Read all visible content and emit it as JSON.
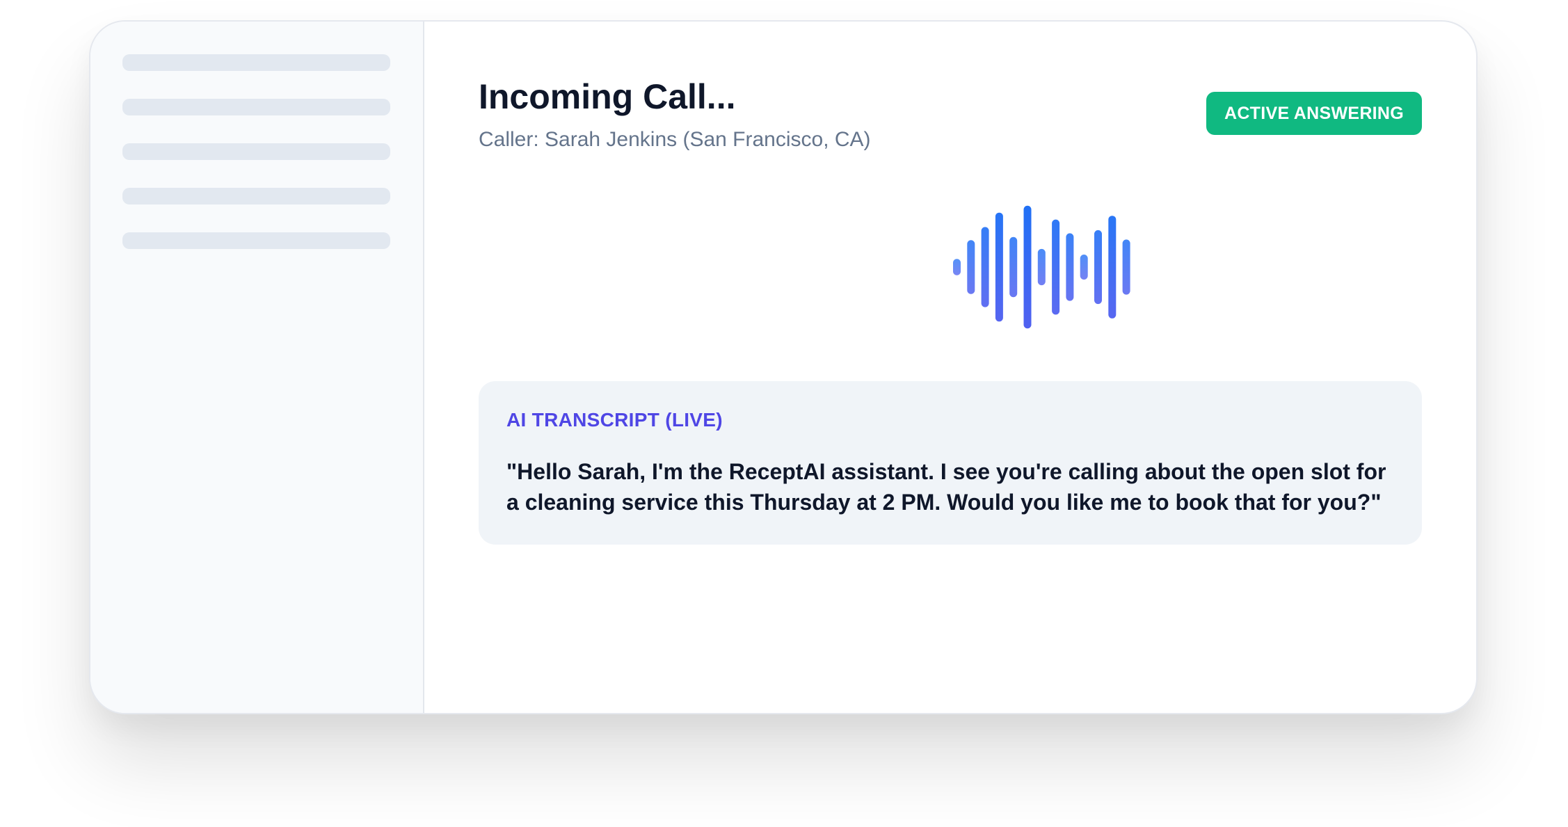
{
  "call": {
    "title": "Incoming Call...",
    "caller": "Caller: Sarah Jenkins (San Francisco, CA)",
    "status_badge": "ACTIVE ANSWERING"
  },
  "transcript": {
    "label": "AI TRANSCRIPT (LIVE)",
    "text": "\"Hello Sarah, I'm the ReceptAI assistant. I see you're calling about the open slot for a cleaning service this Thursday at 2 PM. Would you like me to book that for you?\""
  },
  "waveform": {
    "levels": [
      0.13,
      0.43,
      0.64,
      0.87,
      0.48,
      0.98,
      0.29,
      0.76,
      0.54,
      0.2,
      0.59,
      0.82,
      0.44
    ]
  },
  "colors": {
    "badge": "#10b981",
    "accent": "#4f46e5",
    "wave_top": "#1e6ff5",
    "wave_bottom": "#4f5ff0"
  }
}
